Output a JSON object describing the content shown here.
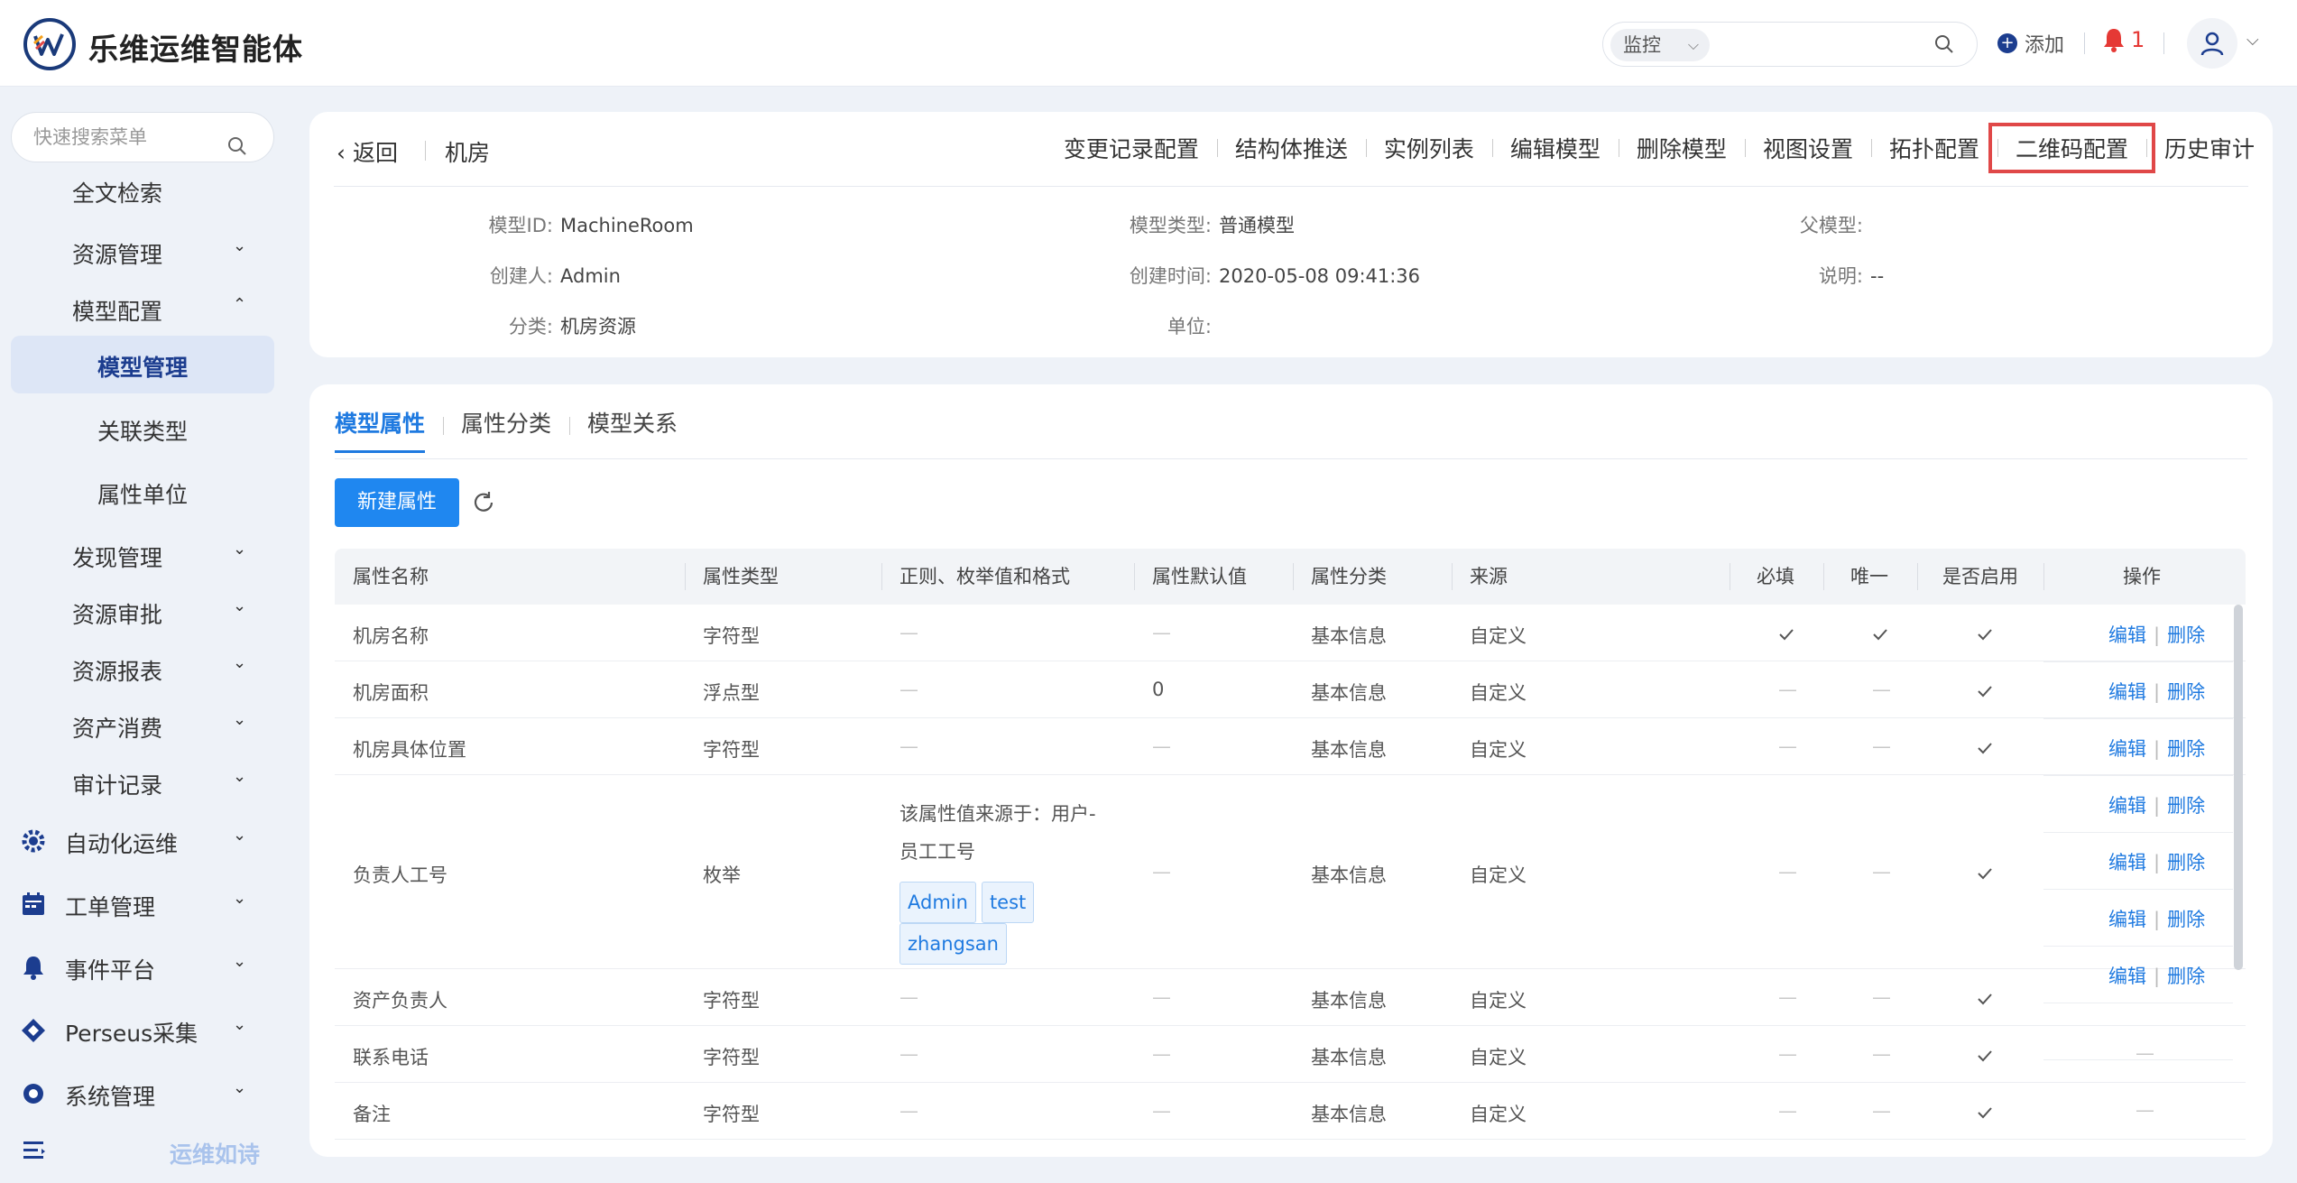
{
  "app": {
    "title": "乐维运维智能体",
    "search_scope": "监控",
    "add_label": "添加",
    "notify_count": "1"
  },
  "sidebar": {
    "search_placeholder": "快速搜索菜单",
    "items": [
      {
        "label": "全文检索"
      },
      {
        "label": "资源管理"
      },
      {
        "label": "模型配置"
      },
      {
        "label": "模型管理"
      },
      {
        "label": "关联类型"
      },
      {
        "label": "属性单位"
      },
      {
        "label": "发现管理"
      },
      {
        "label": "资源审批"
      },
      {
        "label": "资源报表"
      },
      {
        "label": "资产消费"
      },
      {
        "label": "审计记录"
      },
      {
        "label": "自动化运维"
      },
      {
        "label": "工单管理"
      },
      {
        "label": "事件平台"
      },
      {
        "label": "Perseus采集"
      },
      {
        "label": "系统管理"
      }
    ],
    "bottom_label": "运维如诗",
    "accent": "#1c3d8f"
  },
  "detail": {
    "back_label": "返回",
    "model_name": "机房",
    "actions": [
      "变更记录配置",
      "结构体推送",
      "实例列表",
      "编辑模型",
      "删除模型",
      "视图设置",
      "拓扑配置",
      "二维码配置",
      "历史审计"
    ],
    "fields": {
      "model_id_k": "模型ID:",
      "model_id_v": "MachineRoom",
      "model_type_k": "模型类型:",
      "model_type_v": "普通模型",
      "parent_k": "父模型:",
      "parent_v": "",
      "creator_k": "创建人:",
      "creator_v": "Admin",
      "created_k": "创建时间:",
      "created_v": "2020-05-08 09:41:36",
      "desc_k": "说明:",
      "desc_v": "--",
      "category_k": "分类:",
      "category_v": "机房资源",
      "unit_k": "单位:",
      "unit_v": ""
    }
  },
  "main": {
    "tabs": [
      "模型属性",
      "属性分类",
      "模型关系"
    ],
    "new_button": "新建属性",
    "columns": [
      "属性名称",
      "属性类型",
      "正则、枚举值和格式",
      "属性默认值",
      "属性分类",
      "来源",
      "必填",
      "唯一",
      "是否启用",
      "操作"
    ],
    "rows": [
      {
        "name": "机房名称",
        "type": "字符型",
        "format": "—",
        "default": "—",
        "category": "基本信息",
        "source": "自定义",
        "required": true,
        "unique": true,
        "enabled": true
      },
      {
        "name": "机房面积",
        "type": "浮点型",
        "format": "—",
        "default": "0",
        "category": "基本信息",
        "source": "自定义",
        "required": false,
        "unique": false,
        "enabled": true
      },
      {
        "name": "机房具体位置",
        "type": "字符型",
        "format": "—",
        "default": "—",
        "category": "基本信息",
        "source": "自定义",
        "required": false,
        "unique": false,
        "enabled": true
      },
      {
        "name": "负责人工号",
        "type": "枚举",
        "format": "该属性值来源于：用户-员工工号",
        "format_line1": "该属性值来源于：用户-",
        "format_line2": "员工工号",
        "tags": [
          "Admin",
          "test",
          "zhangsan"
        ],
        "default": "—",
        "category": "基本信息",
        "source": "自定义",
        "required": false,
        "unique": false,
        "enabled": true
      },
      {
        "name": "资产负责人",
        "type": "字符型",
        "format": "—",
        "default": "—",
        "category": "基本信息",
        "source": "自定义",
        "required": false,
        "unique": false,
        "enabled": true
      },
      {
        "name": "联系电话",
        "type": "字符型",
        "format": "—",
        "default": "—",
        "category": "基本信息",
        "source": "自定义",
        "required": false,
        "unique": false,
        "enabled": true
      },
      {
        "name": "备注",
        "type": "字符型",
        "format": "—",
        "default": "—",
        "category": "基本信息",
        "source": "自定义",
        "required": false,
        "unique": false,
        "enabled": true
      }
    ],
    "op_edit": "编辑",
    "op_sep": "|",
    "op_delete": "删除",
    "dash": "—",
    "accent": "#1f7ae0"
  }
}
